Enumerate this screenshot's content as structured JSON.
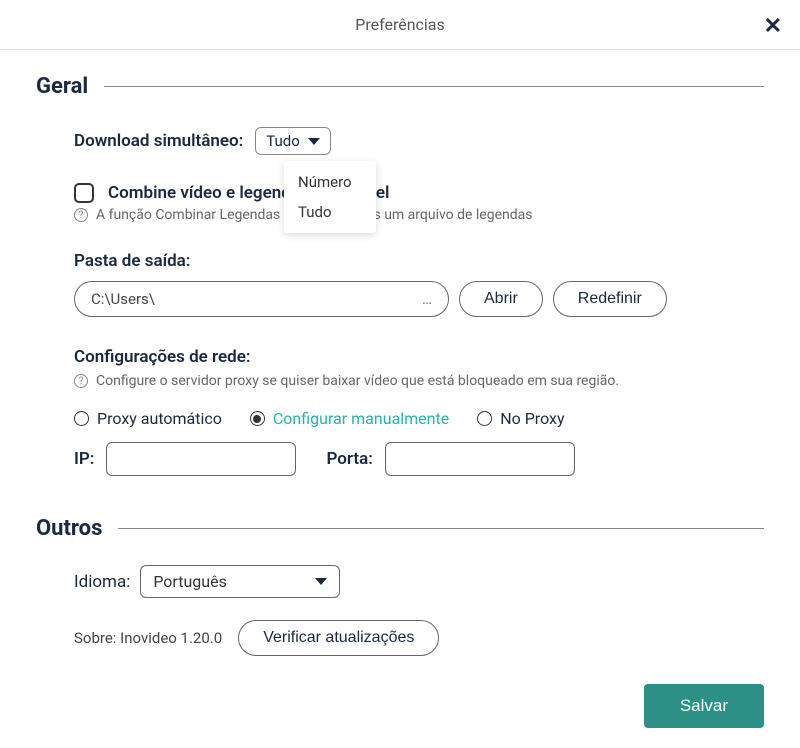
{
  "header": {
    "title": "Preferências"
  },
  "general": {
    "title": "Geral",
    "simultaneous_label": "Download simultâneo:",
    "simultaneous_value": "Tudo",
    "dropdown": {
      "option1": "Número",
      "option2": "Tudo"
    },
    "combine_label": "Combine vídeo e legenda se possível",
    "combine_help": "A função Combinar Legendas suporta apenas um arquivo de legendas",
    "output_folder_label": "Pasta de saída:",
    "output_folder_value": "C:\\Users\\",
    "open_btn": "Abrir",
    "reset_btn": "Redefinir",
    "network_label": "Configurações de rede:",
    "network_help": "Configure o servidor proxy se quiser baixar vídeo que está bloqueado em sua região.",
    "proxy_auto": "Proxy automático",
    "proxy_manual": "Configurar manualmente",
    "proxy_none": "No Proxy",
    "ip_label": "IP:",
    "port_label": "Porta:"
  },
  "others": {
    "title": "Outros",
    "language_label": "Idioma:",
    "language_value": "Português",
    "about_label": "Sobre: Inovideo 1.20.0",
    "check_updates": "Verificar atualizações"
  },
  "save_btn": "Salvar"
}
